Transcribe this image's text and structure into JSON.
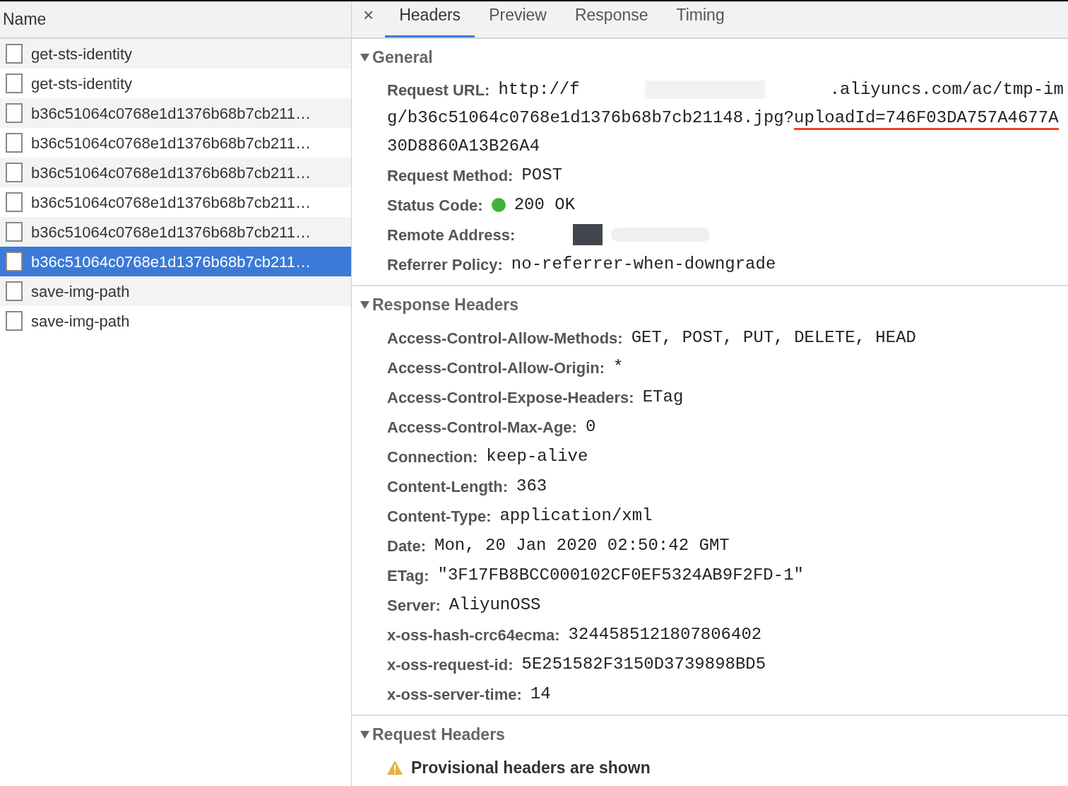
{
  "request_list": {
    "column": "Name",
    "rows": [
      {
        "name": "get-sts-identity",
        "selected": false
      },
      {
        "name": "get-sts-identity",
        "selected": false
      },
      {
        "name": "b36c51064c0768e1d1376b68b7cb211…",
        "selected": false
      },
      {
        "name": "b36c51064c0768e1d1376b68b7cb211…",
        "selected": false
      },
      {
        "name": "b36c51064c0768e1d1376b68b7cb211…",
        "selected": false
      },
      {
        "name": "b36c51064c0768e1d1376b68b7cb211…",
        "selected": false
      },
      {
        "name": "b36c51064c0768e1d1376b68b7cb211…",
        "selected": false
      },
      {
        "name": "b36c51064c0768e1d1376b68b7cb211…",
        "selected": true
      },
      {
        "name": "save-img-path",
        "selected": false
      },
      {
        "name": "save-img-path",
        "selected": false
      }
    ]
  },
  "close": "×",
  "tabs": [
    {
      "label": "Headers",
      "selected": true
    },
    {
      "label": "Preview",
      "selected": false
    },
    {
      "label": "Response",
      "selected": false
    },
    {
      "label": "Timing",
      "selected": false
    }
  ],
  "sections": [
    {
      "title": "General",
      "expanded": true,
      "rows": [
        {
          "kind": "url",
          "label": "Request URL:",
          "value_start": "http://f",
          "value_end": ".aliyuncs.com/ac/tmp-im",
          "line_2": "g/b36c51064c0768e1d1376b68b7cb21148.jpg?",
          "highlighted": "uploadId=746F03DA757A4677A",
          "line_3": "30D8860A13B26A4"
        },
        {
          "kind": "text",
          "label": "Request Method:",
          "value": "POST"
        },
        {
          "kind": "status",
          "label": "Status Code:",
          "value": "200 OK",
          "color": "#3fb43a"
        },
        {
          "kind": "redacted",
          "label": "Remote Address:"
        },
        {
          "kind": "text",
          "label": "Referrer Policy:",
          "value": "no-referrer-when-downgrade"
        }
      ]
    },
    {
      "title": "Response Headers",
      "expanded": true,
      "rows": [
        {
          "kind": "text",
          "label": "Access-Control-Allow-Methods:",
          "value": "GET, POST, PUT, DELETE, HEAD"
        },
        {
          "kind": "text",
          "label": "Access-Control-Allow-Origin:",
          "value": "*"
        },
        {
          "kind": "text",
          "label": "Access-Control-Expose-Headers:",
          "value": "ETag"
        },
        {
          "kind": "text",
          "label": "Access-Control-Max-Age:",
          "value": "0"
        },
        {
          "kind": "text",
          "label": "Connection:",
          "value": "keep-alive"
        },
        {
          "kind": "text",
          "label": "Content-Length:",
          "value": "363"
        },
        {
          "kind": "text",
          "label": "Content-Type:",
          "value": "application/xml"
        },
        {
          "kind": "text",
          "label": "Date:",
          "value": "Mon, 20 Jan 2020 02:50:42 GMT"
        },
        {
          "kind": "text",
          "label": "ETag:",
          "value": "\"3F17FB8BCC000102CF0EF5324AB9F2FD-1\""
        },
        {
          "kind": "text",
          "label": "Server:",
          "value": "AliyunOSS"
        },
        {
          "kind": "text",
          "label": "x-oss-hash-crc64ecma:",
          "value": "3244585121807806402"
        },
        {
          "kind": "text",
          "label": "x-oss-request-id:",
          "value": "5E251582F3150D3739898BD5"
        },
        {
          "kind": "text",
          "label": "x-oss-server-time:",
          "value": "14"
        }
      ]
    },
    {
      "title": "Request Headers",
      "expanded": true,
      "rows": [
        {
          "kind": "warning",
          "text": "Provisional headers are shown"
        }
      ]
    }
  ]
}
